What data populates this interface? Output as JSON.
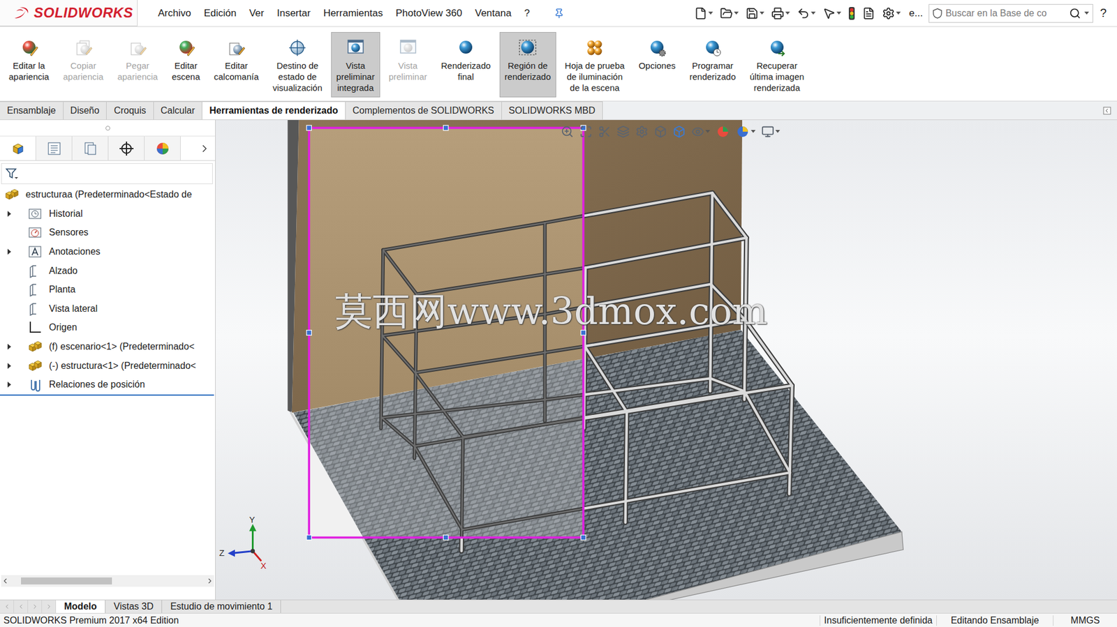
{
  "window": {
    "logo": "SOLIDWORKS"
  },
  "menu": [
    "Archivo",
    "Edición",
    "Ver",
    "Insertar",
    "Herramientas",
    "PhotoView 360",
    "Ventana",
    "?"
  ],
  "quick_access": {
    "overflow": "e...",
    "search_placeholder": "Buscar en la Base de co",
    "help": "?"
  },
  "ribbon": [
    {
      "lines": [
        "Editar la",
        "apariencia"
      ],
      "kind": "appearance",
      "selected": false,
      "disabled": false
    },
    {
      "lines": [
        "Copiar",
        "apariencia"
      ],
      "kind": "copy",
      "selected": false,
      "disabled": true
    },
    {
      "lines": [
        "Pegar",
        "apariencia"
      ],
      "kind": "paste",
      "selected": false,
      "disabled": true
    },
    {
      "lines": [
        "Editar",
        "escena"
      ],
      "kind": "scene",
      "selected": false,
      "disabled": false
    },
    {
      "lines": [
        "Editar",
        "calcomanía"
      ],
      "kind": "decal",
      "selected": false,
      "disabled": false
    },
    {
      "lines": [
        "Destino de",
        "estado de",
        "visualización"
      ],
      "kind": "display-state",
      "selected": false,
      "disabled": false
    },
    {
      "lines": [
        "Vista",
        "preliminar",
        "integrada"
      ],
      "kind": "preview-integrated",
      "selected": true,
      "disabled": false
    },
    {
      "lines": [
        "Vista",
        "preliminar"
      ],
      "kind": "preview",
      "selected": false,
      "disabled": true
    },
    {
      "lines": [
        "Renderizado",
        "final"
      ],
      "kind": "final-render",
      "selected": false,
      "disabled": false
    },
    {
      "lines": [
        "Región de",
        "renderizado"
      ],
      "kind": "region",
      "selected": true,
      "disabled": false
    },
    {
      "lines": [
        "Hoja de prueba",
        "de iluminación",
        "de la escena"
      ],
      "kind": "lighting",
      "selected": false,
      "disabled": false
    },
    {
      "lines": [
        "Opciones"
      ],
      "kind": "options",
      "selected": false,
      "disabled": false
    },
    {
      "lines": [
        "Programar",
        "renderizado"
      ],
      "kind": "schedule",
      "selected": false,
      "disabled": false
    },
    {
      "lines": [
        "Recuperar",
        "última imagen",
        "renderizada"
      ],
      "kind": "recover",
      "selected": false,
      "disabled": false
    }
  ],
  "tabs": [
    {
      "label": "Ensamblaje",
      "selected": false
    },
    {
      "label": "Diseño",
      "selected": false
    },
    {
      "label": "Croquis",
      "selected": false
    },
    {
      "label": "Calcular",
      "selected": false
    },
    {
      "label": "Herramientas de renderizado",
      "selected": true
    },
    {
      "label": "Complementos de SOLIDWORKS",
      "selected": false
    },
    {
      "label": "SOLIDWORKS MBD",
      "selected": false
    }
  ],
  "feature_tree": {
    "items": [
      {
        "label": "estructuraa (Predeterminado<Estado de",
        "kind": "assembly",
        "depth": 0,
        "expandable": false
      },
      {
        "label": "Historial",
        "kind": "history",
        "depth": 1,
        "expandable": true
      },
      {
        "label": "Sensores",
        "kind": "sensor",
        "depth": 1,
        "expandable": false
      },
      {
        "label": "Anotaciones",
        "kind": "annotation",
        "depth": 1,
        "expandable": true
      },
      {
        "label": "Alzado",
        "kind": "plane",
        "depth": 1,
        "expandable": false
      },
      {
        "label": "Planta",
        "kind": "plane",
        "depth": 1,
        "expandable": false
      },
      {
        "label": "Vista lateral",
        "kind": "plane",
        "depth": 1,
        "expandable": false
      },
      {
        "label": "Origen",
        "kind": "origin",
        "depth": 1,
        "expandable": false
      },
      {
        "label": "(f) escenario<1> (Predeterminado<",
        "kind": "component",
        "depth": 1,
        "expandable": true
      },
      {
        "label": "(-) estructura<1> (Predeterminado<",
        "kind": "component",
        "depth": 1,
        "expandable": true
      },
      {
        "label": "Relaciones de posición",
        "kind": "mates",
        "depth": 1,
        "expandable": true
      }
    ]
  },
  "viewport": {
    "watermark": "莫西网www.3dmox.com",
    "render_region": {
      "visible": true
    },
    "triad": {
      "y": "Y",
      "z": "Z",
      "x": "X"
    }
  },
  "bottom_tabs": [
    {
      "label": "Modelo",
      "selected": true
    },
    {
      "label": "Vistas 3D",
      "selected": false
    },
    {
      "label": "Estudio de movimiento 1",
      "selected": false
    }
  ],
  "status_bar": [
    "SOLIDWORKS Premium 2017 x64 Edition",
    "Insuficientemente definida",
    "Editando Ensamblaje",
    "MMGS"
  ]
}
